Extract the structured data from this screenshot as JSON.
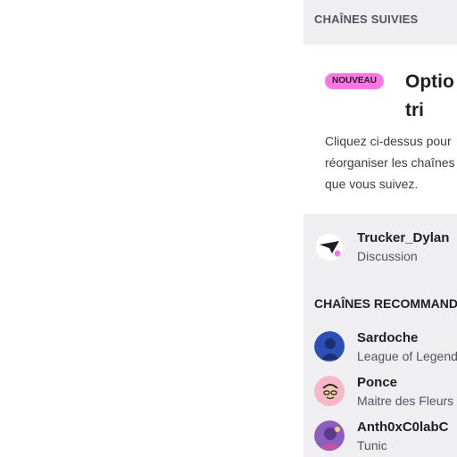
{
  "followed": {
    "header": "CHAÎNES SUIVIES",
    "notice": {
      "badge": "NOUVEAU",
      "title": "Optio tri",
      "text": "Cliquez ci-dessus pour réorganiser les chaînes que vous suivez."
    },
    "channels": [
      {
        "name": "Trucker_Dylan",
        "category": "Discussion",
        "icon": "paper-plane-icon"
      }
    ]
  },
  "recommended": {
    "header": "CHAÎNES RECOMMANDÉES",
    "channels": [
      {
        "name": "Sardoche",
        "category": "League of Legends"
      },
      {
        "name": "Ponce",
        "category": "Maitre des Fleurs"
      },
      {
        "name": "Anth0xC0labC",
        "category": "Tunic"
      }
    ]
  },
  "colors": {
    "sidebar_bg": "#efeff1",
    "badge_bg": "#ff75e6",
    "live_dot": "#eb0400"
  }
}
